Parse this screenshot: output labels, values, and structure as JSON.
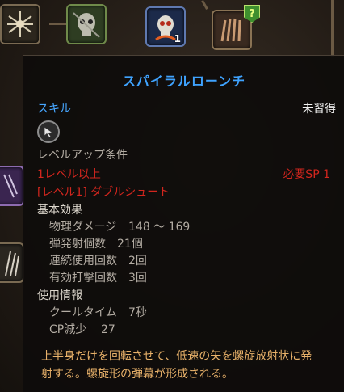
{
  "skill_tree": {
    "node_2_badge": "?",
    "node_3_count": "1"
  },
  "tooltip": {
    "title": "スパイラルローンチ",
    "category": "スキル",
    "status": "未習得",
    "levelup_header": "レベルアップ条件",
    "req_level": "1レベル以上",
    "req_sp": "必要SP 1",
    "req_skill": "[レベル1] ダブルシュート",
    "base_effect_header": "基本効果",
    "base_effects": [
      {
        "label": "物理ダメージ",
        "value": "148 ～ 169"
      },
      {
        "label": "弾発射個数",
        "value": "21個"
      },
      {
        "label": "連続使用回数",
        "value": "2回"
      },
      {
        "label": "有効打撃回数",
        "value": "3回"
      }
    ],
    "usage_header": "使用情報",
    "usage": [
      {
        "label": "クールタイム",
        "value": "7秒"
      },
      {
        "label": "CP減少",
        "value": "27"
      }
    ],
    "description_line1": "上半身だけを回転させて、低速の矢を螺旋放射状に発",
    "description_line2": "射する。螺旋形の弾幕が形成される。"
  },
  "colors": {
    "title": "#3fa3ff",
    "category": "#46a6ff",
    "requirement_unmet": "#d2261e",
    "description": "#e9b26a"
  },
  "icons": [
    "crossed-arrows-icon",
    "skull-icon",
    "flaming-skull-icon",
    "claw-icon",
    "arrow-cursor-icon"
  ]
}
